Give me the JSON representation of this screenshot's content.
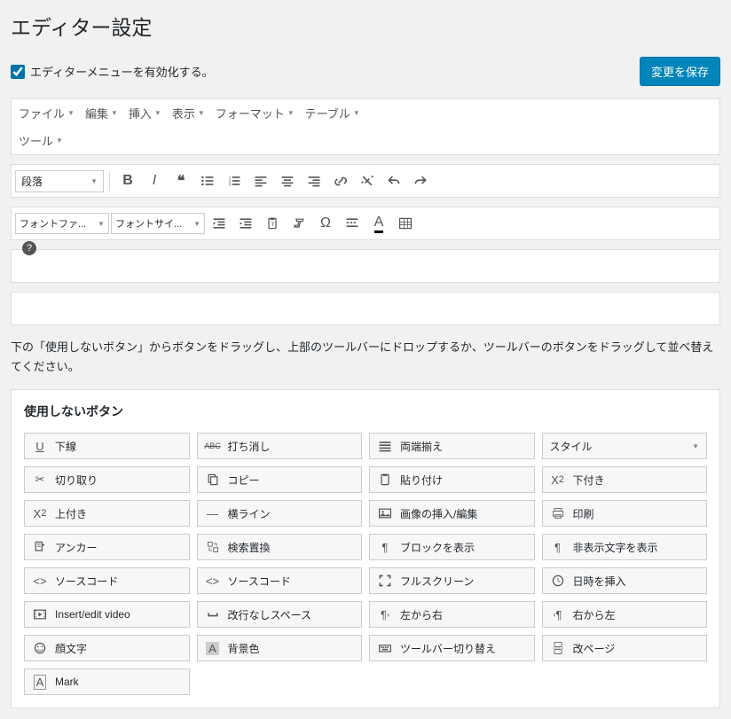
{
  "page_title": "エディター設定",
  "enable_checkbox_label": "エディターメニューを有効化する。",
  "save_button": "変更を保存",
  "menubar": [
    "ファイル",
    "編集",
    "挿入",
    "表示",
    "フォーマット",
    "テーブル",
    "ツール"
  ],
  "format_select": "段落",
  "font_family_select": "フォントファ...",
  "font_size_select": "フォントサイ...",
  "instructions": "下の「使用しないボタン」からボタンをドラッグし、上部のツールバーにドロップするか、ツールバーのボタンをドラッグして並べ替えてください。",
  "unused_title": "使用しないボタン",
  "unused": {
    "underline": "下線",
    "strike": "打ち消し",
    "justify": "両端揃え",
    "styles": "スタイル",
    "cut": "切り取り",
    "copy": "コピー",
    "paste": "貼り付け",
    "subscript": "下付き",
    "superscript": "上付き",
    "hr": "横ライン",
    "image": "画像の挿入/編集",
    "print": "印刷",
    "anchor": "アンカー",
    "search": "検索置換",
    "show_blocks": "ブロックを表示",
    "show_invisible": "非表示文字を表示",
    "source1": "ソースコード",
    "source2": "ソースコード",
    "fullscreen": "フルスクリーン",
    "insert_date": "日時を挿入",
    "video": "Insert/edit video",
    "nbsp": "改行なしスペース",
    "ltr": "左から右",
    "rtl": "右から左",
    "emoji": "顔文字",
    "bgcolor": "背景色",
    "toggle_toolbar": "ツールバー切り替え",
    "pagebreak": "改ページ",
    "mark": "Mark"
  }
}
